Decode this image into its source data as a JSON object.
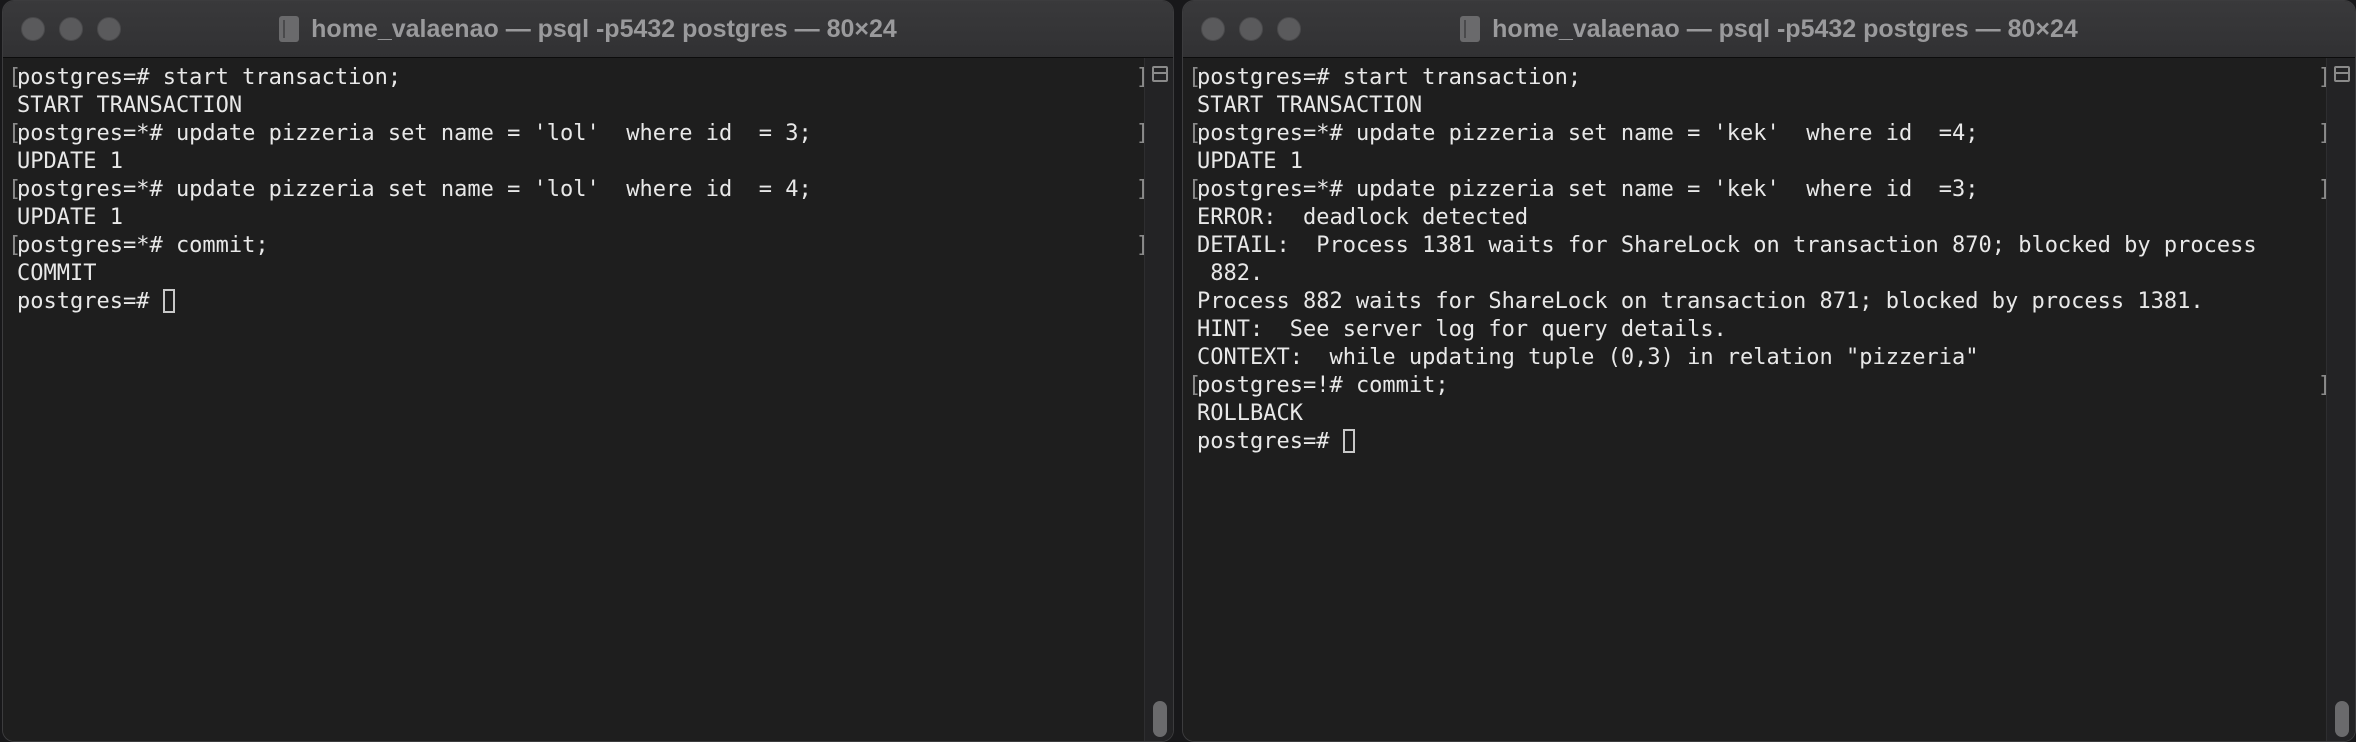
{
  "windows": [
    {
      "title": "home_valaenao — psql -p5432 postgres — 80×24",
      "lines": [
        {
          "text": "postgres=# start transaction;",
          "mark_left": "[",
          "mark_right": "]"
        },
        {
          "text": "START TRANSACTION",
          "mark_left": "",
          "mark_right": ""
        },
        {
          "text": "postgres=*# update pizzeria set name = 'lol'  where id  = 3;",
          "mark_left": "[",
          "mark_right": "]"
        },
        {
          "text": "UPDATE 1",
          "mark_left": "",
          "mark_right": ""
        },
        {
          "text": "postgres=*# update pizzeria set name = 'lol'  where id  = 4;",
          "mark_left": "[",
          "mark_right": "]"
        },
        {
          "text": "UPDATE 1",
          "mark_left": "",
          "mark_right": ""
        },
        {
          "text": "postgres=*# commit;",
          "mark_left": "[",
          "mark_right": "]"
        },
        {
          "text": "COMMIT",
          "mark_left": "",
          "mark_right": ""
        },
        {
          "text": "postgres=# ",
          "mark_left": "",
          "mark_right": "",
          "cursor": true
        }
      ]
    },
    {
      "title": "home_valaenao — psql -p5432 postgres — 80×24",
      "lines": [
        {
          "text": "postgres=# start transaction;",
          "mark_left": "[",
          "mark_right": "]"
        },
        {
          "text": "START TRANSACTION",
          "mark_left": "",
          "mark_right": ""
        },
        {
          "text": "postgres=*# update pizzeria set name = 'kek'  where id  =4;",
          "mark_left": "[",
          "mark_right": "]"
        },
        {
          "text": "UPDATE 1",
          "mark_left": "",
          "mark_right": ""
        },
        {
          "text": "postgres=*# update pizzeria set name = 'kek'  where id  =3;",
          "mark_left": "[",
          "mark_right": "]"
        },
        {
          "text": "ERROR:  deadlock detected",
          "mark_left": "",
          "mark_right": ""
        },
        {
          "text": "DETAIL:  Process 1381 waits for ShareLock on transaction 870; blocked by process",
          "mark_left": "",
          "mark_right": ""
        },
        {
          "text": " 882.",
          "mark_left": "",
          "mark_right": ""
        },
        {
          "text": "Process 882 waits for ShareLock on transaction 871; blocked by process 1381.",
          "mark_left": "",
          "mark_right": ""
        },
        {
          "text": "HINT:  See server log for query details.",
          "mark_left": "",
          "mark_right": ""
        },
        {
          "text": "CONTEXT:  while updating tuple (0,3) in relation \"pizzeria\"",
          "mark_left": "",
          "mark_right": ""
        },
        {
          "text": "postgres=!# commit;",
          "mark_left": "[",
          "mark_right": "]"
        },
        {
          "text": "ROLLBACK",
          "mark_left": "",
          "mark_right": ""
        },
        {
          "text": "postgres=# ",
          "mark_left": "",
          "mark_right": "",
          "cursor": true
        }
      ]
    }
  ]
}
